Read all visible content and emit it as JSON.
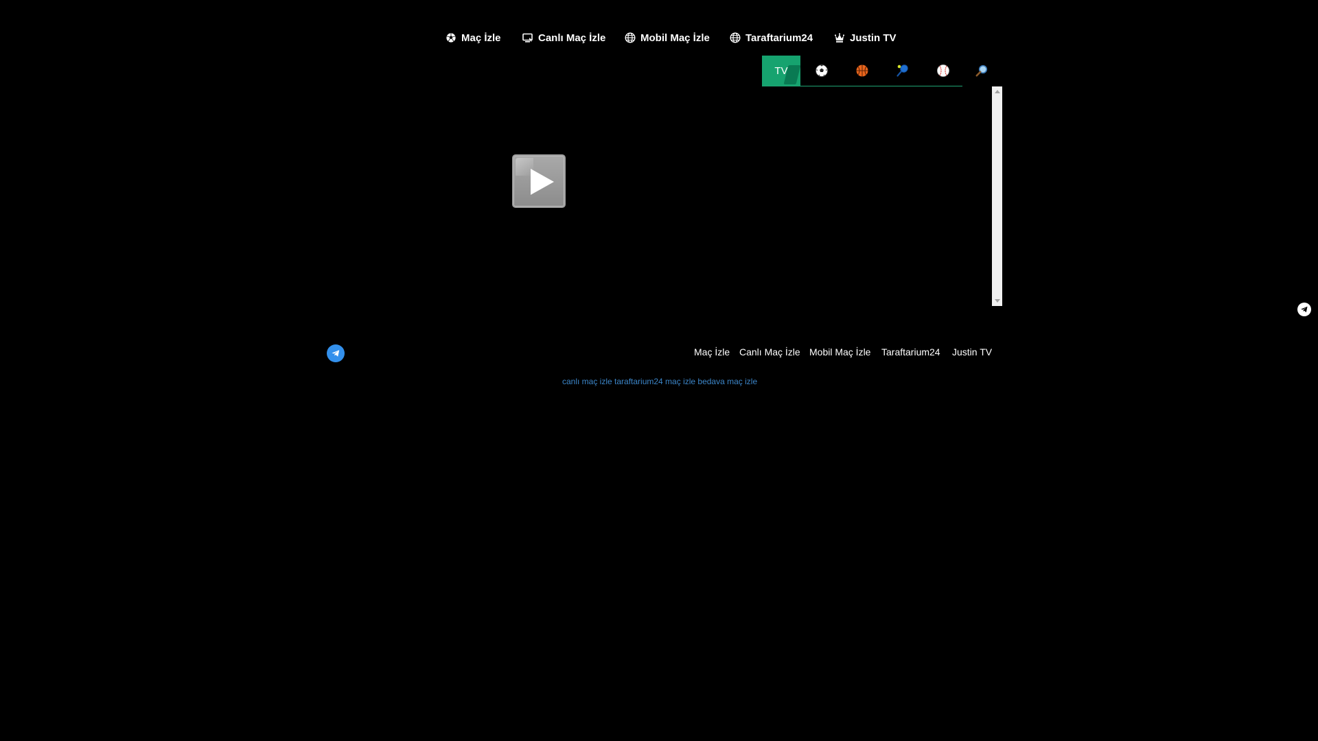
{
  "topnav": {
    "items": [
      {
        "label": "Maç İzle",
        "icon": "soccer-ball-icon"
      },
      {
        "label": "Canlı Maç İzle",
        "icon": "monitor-icon"
      },
      {
        "label": "Mobil Maç İzle",
        "icon": "globe-icon"
      },
      {
        "label": "Taraftarium24",
        "icon": "globe-icon"
      },
      {
        "label": "Justin TV",
        "icon": "crown-icon"
      }
    ]
  },
  "sport_tabs": {
    "tv_label": "TV",
    "tabs": [
      "tv-icon",
      "soccer-icon",
      "basketball-icon",
      "tennis-icon",
      "baseball-icon",
      "search-icon"
    ],
    "active": "TV",
    "accent": "#16a36f"
  },
  "player": {
    "play_icon": "play-icon"
  },
  "footer": {
    "links": [
      "Maç İzle",
      "Canlı Maç İzle",
      "Mobil Maç İzle",
      "Taraftarium24",
      "Justin TV"
    ],
    "seo_text": "canlı maç izle taraftarium24 maç izle bedava maç izle",
    "telegram_color": "#3390ec",
    "seo_color": "#3c86c9"
  }
}
